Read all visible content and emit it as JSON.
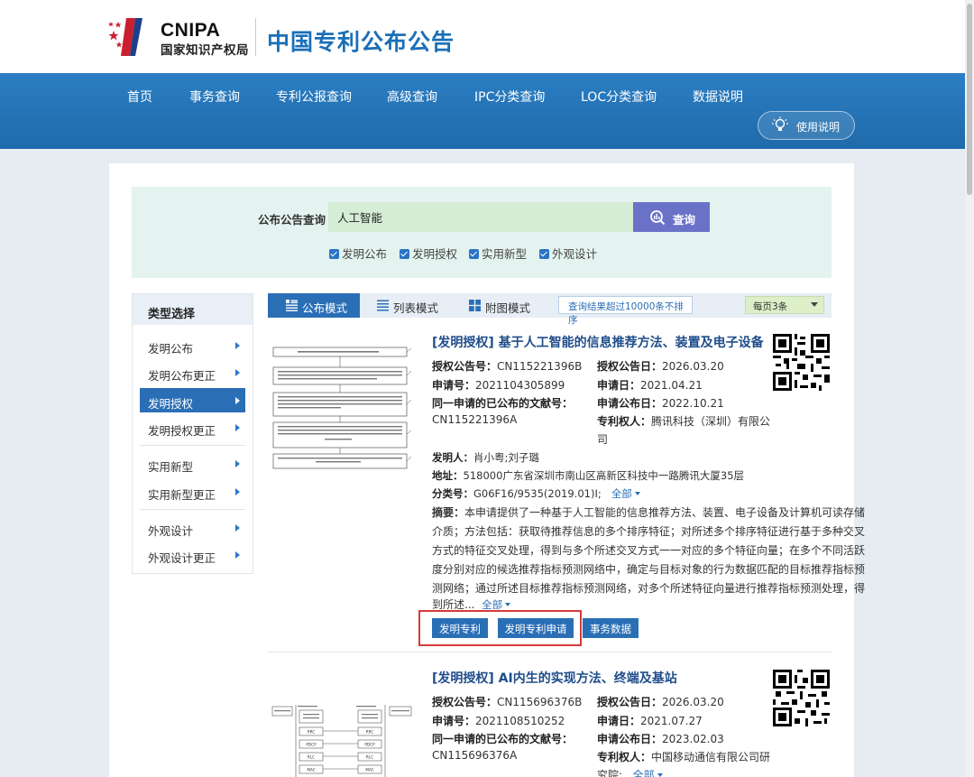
{
  "header": {
    "logo_abbr": "CNIPA",
    "logo_name": "国家知识产权局",
    "site_title": "中国专利公布公告"
  },
  "nav": {
    "items": [
      "首页",
      "事务查询",
      "专利公报查询",
      "高级查询",
      "IPC分类查询",
      "LOC分类查询",
      "数据说明"
    ],
    "help_label": "使用说明"
  },
  "search": {
    "label": "公布公告查询",
    "query": "人工智能",
    "button_label": "查询",
    "filters": [
      {
        "label": "发明公布",
        "checked": true
      },
      {
        "label": "发明授权",
        "checked": true
      },
      {
        "label": "实用新型",
        "checked": true
      },
      {
        "label": "外观设计",
        "checked": true
      }
    ]
  },
  "sidebar": {
    "title": "类型选择",
    "items": [
      {
        "label": "发明公布",
        "active": false
      },
      {
        "label": "发明公布更正",
        "active": false
      },
      {
        "label": "发明授权",
        "active": true
      },
      {
        "label": "发明授权更正",
        "active": false
      },
      {
        "label": "实用新型",
        "active": false
      },
      {
        "label": "实用新型更正",
        "active": false
      },
      {
        "label": "外观设计",
        "active": false
      },
      {
        "label": "外观设计更正",
        "active": false
      }
    ]
  },
  "toolbar": {
    "modes": [
      "公布模式",
      "列表模式",
      "附图模式"
    ],
    "active_mode": "公布模式",
    "notice": "查询结果超过10000条不排序",
    "per_page": "每页3条"
  },
  "records": [
    {
      "title": "[发明授权] 基于人工智能的信息推荐方法、装置及电子设备",
      "grant_no_label": "授权公告号：",
      "grant_no": "CN115221396B",
      "grant_date_label": "授权公告日：",
      "grant_date": "2026.03.20",
      "app_no_label": "申请号：",
      "app_no": "2021104305899",
      "app_date_label": "申请日：",
      "app_date": "2021.04.21",
      "pub_doc_label": "同一申请的已公布的文献号：",
      "pub_doc": "CN115221396A",
      "pub_date_label": "申请公布日：",
      "pub_date": "2022.10.21",
      "patentee_label": "专利权人：",
      "patentee_line1": "腾讯科技（深圳）有限公",
      "patentee_line2": "司",
      "inventor_label": "发明人：",
      "inventor": "肖小粤;刘子璐",
      "address_label": "地址：",
      "address": "518000广东省深圳市南山区高新区科技中一路腾讯大厦35层",
      "class_label": "分类号：",
      "class": "G06F16/9535(2019.01)I;",
      "more": "全部",
      "abstract_label": "摘要：",
      "abstract_lines": [
        "本申请提供了一种基于人工智能的信息推荐方法、装置、电子设备及计算机可读存储",
        "介质；方法包括：获取待推荐信息的多个排序特征；对所述多个排序特征进行基于多种交叉",
        "方式的特征交叉处理，得到与多个所述交叉方式一一对应的多个特征向量；在多个不同活跃",
        "度分别对应的候选推荐指标预测网络中，确定与目标对象的行为数据匹配的目标推荐指标预",
        "测网络；通过所述目标推荐指标预测网络，对多个所述特征向量进行推荐指标预测处理，得",
        "到所述..."
      ],
      "buttons": [
        "发明专利",
        "发明专利申请",
        "事务数据"
      ],
      "drawing": {
        "labels": [
          "101",
          "102",
          "103",
          "104",
          "105"
        ],
        "steps": [
          "获取待推荐信息的多个排序特征",
          "对多个排序特征进行基于多种交叉方式的特征交叉处理",
          "在多个不同活跃度分别对应的候选推荐指标预测网络中确定目标推荐指标预测网络",
          "通过目标推荐指标预测网络对多个特征向量进行推荐指标预测处理",
          "基于不同的待推荐信息的推荐指标执行针对目标对象的推荐操作"
        ]
      }
    },
    {
      "title": "[发明授权] AI内生的实现方法、终端及基站",
      "grant_no_label": "授权公告号：",
      "grant_no": "CN115696376B",
      "grant_date_label": "授权公告日：",
      "grant_date": "2026.03.20",
      "app_no_label": "申请号：",
      "app_no": "2021108510252",
      "app_date_label": "申请日：",
      "app_date": "2021.07.27",
      "pub_doc_label": "同一申请的已公布的文献号：",
      "pub_doc": "CN115696376A",
      "pub_date_label": "申请公布日：",
      "pub_date": "2023.02.03",
      "patentee_label": "专利权人：",
      "patentee_line1": "中国移动通信有限公司研",
      "patentee_line2": "究院;",
      "more": "全部",
      "drawing": {
        "left_stack": [
          "RRC",
          "PDCP",
          "RLC",
          "MAC",
          "PHY"
        ],
        "right_stack": [
          "RRC",
          "PDCP",
          "RLC",
          "MAC",
          "PHY"
        ]
      }
    }
  ],
  "colors": {
    "brand_blue": "#1a6fb7",
    "nav_blue": "#2474b8",
    "active_blue": "#2a6fb6",
    "search_bg": "#e4f3ef",
    "highlight_red": "#d83a3a"
  }
}
